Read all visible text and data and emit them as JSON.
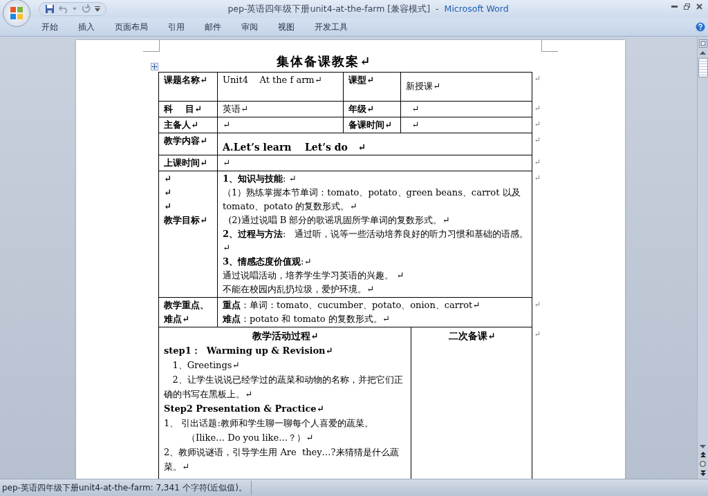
{
  "window": {
    "document_title": "pep-英语四年级下册unit4-at-the-farm [兼容模式]",
    "separator": "-",
    "app_name": "Microsoft Word"
  },
  "ribbon_tabs": [
    {
      "label": "开始"
    },
    {
      "label": "插入"
    },
    {
      "label": "页面布局"
    },
    {
      "label": "引用"
    },
    {
      "label": "邮件"
    },
    {
      "label": "审阅"
    },
    {
      "label": "视图"
    },
    {
      "label": "开发工具"
    }
  ],
  "document": {
    "heading": "集体备课教案↵",
    "table": {
      "rows": [
        {
          "end_mark": "↵",
          "cells": [
            {
              "bold": true,
              "lines": [
                "课题名称↵"
              ]
            },
            {
              "bold": false,
              "lines": [
                "Unit4    At the f arm↵"
              ]
            },
            {
              "bold": true,
              "lines": [
                "课型↵"
              ]
            },
            {
              "bold": false,
              "lines": [
                "新授课↵"
              ]
            }
          ]
        },
        {
          "end_mark": "↵",
          "cells": [
            {
              "bold": true,
              "lines": [
                "科    目↵"
              ]
            },
            {
              "bold": false,
              "lines": [
                "英语↵"
              ]
            },
            {
              "bold": true,
              "lines": [
                "年级↵"
              ]
            },
            {
              "bold": false,
              "lines": [
                "  ↵"
              ]
            }
          ]
        },
        {
          "end_mark": "↵",
          "cells": [
            {
              "bold": true,
              "lines": [
                "主备人↵"
              ]
            },
            {
              "bold": false,
              "lines": [
                "↵"
              ]
            },
            {
              "bold": true,
              "lines": [
                "备课时间↵"
              ]
            },
            {
              "bold": false,
              "lines": [
                "  ↵"
              ]
            }
          ]
        },
        {
          "end_mark": "↵",
          "cells": [
            {
              "bold": true,
              "lines": [
                "教学内容↵"
              ]
            },
            {
              "bold": true,
              "lines": [
                "A.Let’s learn    Let’s do   ↵"
              ]
            }
          ]
        },
        {
          "end_mark": "↵",
          "cells": [
            {
              "bold": true,
              "lines": [
                "上课时间↵"
              ]
            },
            {
              "bold": false,
              "lines": [
                "↵"
              ]
            }
          ]
        },
        {
          "end_mark": "↵",
          "cells": [
            {
              "bold": true,
              "lines": [
                "↵",
                "↵",
                "↵",
                "教学目标↵"
              ]
            },
            {
              "bold": false,
              "lines": [
                "**1、知识与技能**: ↵",
                "（1）熟练掌握本节单词：tomato、potato、green beans、carrot 以及 tomato、potato 的复数形式。↵",
                "  (2)通过说唱 B 部分的歌谣巩固所学单词的复数形式。↵",
                "**2、过程与方法**:   通过听，说等一些活动培养良好的听力习惯和基础的语感。↵",
                "**3、情感态度价值观**:↵",
                "通过说唱活动，培养学生学习英语的兴趣。 ↵",
                "不能在校园内乱扔垃圾，爱护环境。↵"
              ]
            }
          ]
        },
        {
          "end_mark": "↵",
          "cells": [
            {
              "bold": true,
              "lines": [
                "教学重点、难点↵"
              ]
            },
            {
              "bold": false,
              "lines": [
                "**重点**：单词：tomato、cucumber、potato、onion、carrot↵",
                "**难点**：potato 和 tomato 的复数形式。↵"
              ]
            }
          ]
        }
      ]
    },
    "process": {
      "end_mark": "↵",
      "heading": "教学活动过程↵",
      "side_heading": "二次备课↵",
      "paragraphs": [
        {
          "bold": true,
          "text": "step1：  Warming up & Revision↵"
        },
        {
          "bold": false,
          "text": "   1、Greetings↵"
        },
        {
          "bold": false,
          "text": "   2、让学生说说已经学过的蔬菜和动物的名称，并把它们正确的书写在黑板上。↵"
        },
        {
          "bold": true,
          "text": "Step2 Presentation & Practice↵"
        },
        {
          "bold": false,
          "text": "1、 引出话题:教师和学生聊一聊每个人喜爱的蔬菜。"
        },
        {
          "bold": false,
          "text": "        （Ilike… Do you like…？）↵"
        },
        {
          "bold": false,
          "text": "2、教师说谜语，引导学生用 Are  they…?来猜猜是什么蔬菜。↵"
        }
      ]
    }
  },
  "status_bar": {
    "text": "pep-英语四年级下册unit4-at-the-farm: 7,341 个字符(近似值)。"
  }
}
